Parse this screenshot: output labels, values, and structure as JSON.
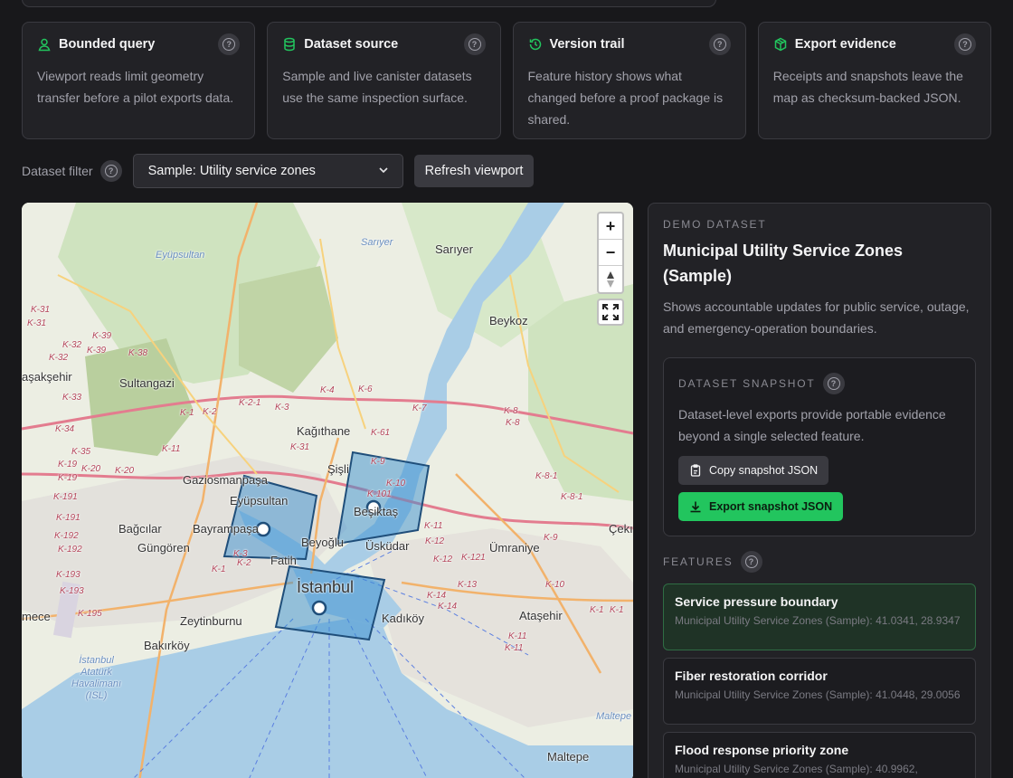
{
  "cards": [
    {
      "title": "Bounded query",
      "icon": "user-pin-icon",
      "text": "Viewport reads limit geometry transfer before a pilot exports data."
    },
    {
      "title": "Dataset source",
      "icon": "database-icon",
      "text": "Sample and live canister datasets use the same inspection surface."
    },
    {
      "title": "Version trail",
      "icon": "history-icon",
      "text": "Feature history shows what changed before a proof package is shared."
    },
    {
      "title": "Export evidence",
      "icon": "package-icon",
      "text": "Receipts and snapshots leave the map as checksum-backed JSON."
    }
  ],
  "help_glyph": "?",
  "filter": {
    "label": "Dataset filter",
    "selected": "Sample: Utility service zones",
    "refresh_label": "Refresh viewport"
  },
  "map": {
    "zoom_in": "+",
    "zoom_out": "−",
    "compass": "▲",
    "labels": {
      "sariyer": "Sarıyer",
      "sariyer_water": "Sarıyer",
      "eyupsultan_top": "Eyüpsultan",
      "beykoz": "Beykoz",
      "basaksehir": "aşakşehir",
      "sultangazi": "Sultangazi",
      "kagithane": "Kağıthane",
      "sisli": "Şişli",
      "gaziosmanpasa": "Gaziosmanpaşa",
      "eyupsultan": "Eyüpsultan",
      "besiktas": "Beşiktaş",
      "bagcilar": "Bağcılar",
      "bayrampasa": "Bayrampaşa",
      "gungoren": "Güngören",
      "beyoglu": "Beyoğlu",
      "uskudar": "Üsküdar",
      "umraniye": "Ümraniye",
      "fatih": "Fatih",
      "istanbul": "İstanbul",
      "cekmekoy": "Çekı",
      "esenyurt": "mece",
      "zeytinburnu": "Zeytinburnu",
      "kadikoy": "Kadıköy",
      "atasehir": "Ataşehir",
      "bakirkoy": "Bakırköy",
      "airport": "İstanbul\nAtatürk\nHavalimanı\n(ISL)",
      "maltepe": "Maltepe",
      "maltepe_water": "Maltepe"
    },
    "roads": [
      "K-31",
      "K-31",
      "K-32",
      "K-32",
      "K-39",
      "K-39",
      "K-38",
      "K-33",
      "K-34",
      "K-35",
      "K-19",
      "K-20",
      "K-20",
      "K-19",
      "K-191",
      "K-191",
      "K-192",
      "K-192",
      "K-193",
      "K-193",
      "K-195",
      "K-1",
      "K-2",
      "K-2-1",
      "K-3",
      "K-4",
      "K-6",
      "K-7",
      "K-8",
      "K-8",
      "K-61",
      "K-31",
      "K-9",
      "K-101",
      "K-10",
      "K-11",
      "K-11",
      "K-12",
      "K-12",
      "K-121",
      "K-13",
      "K-14",
      "K-14",
      "K-10",
      "K-8-1",
      "K-8-1",
      "K-9",
      "K-1",
      "K-1",
      "K-11",
      "K-11",
      "K-3",
      "K-2",
      "K-1"
    ]
  },
  "panel": {
    "eyebrow": "DEMO DATASET",
    "title": "Municipal Utility Service Zones (Sample)",
    "description": "Shows accountable updates for public service, outage, and emergency-operation boundaries.",
    "snapshot": {
      "eyebrow": "DATASET SNAPSHOT",
      "text": "Dataset-level exports provide portable evidence beyond a single selected feature.",
      "copy_label": "Copy snapshot JSON",
      "export_label": "Export snapshot JSON"
    },
    "features_eyebrow": "FEATURES",
    "features": [
      {
        "title": "Service pressure boundary",
        "subtitle": "Municipal Utility Service Zones (Sample): 41.0341, 28.9347",
        "active": true
      },
      {
        "title": "Fiber restoration corridor",
        "subtitle": "Municipal Utility Service Zones (Sample): 41.0448, 29.0056",
        "active": false
      },
      {
        "title": "Flood response priority zone",
        "subtitle": "Municipal Utility Service Zones (Sample): 40.9962,",
        "active": false
      }
    ]
  },
  "colors": {
    "accent_green": "#22c55e",
    "zone_fill": "#3a8fd0",
    "zone_stroke": "#1f4e7a",
    "water": "#a9cde6"
  }
}
